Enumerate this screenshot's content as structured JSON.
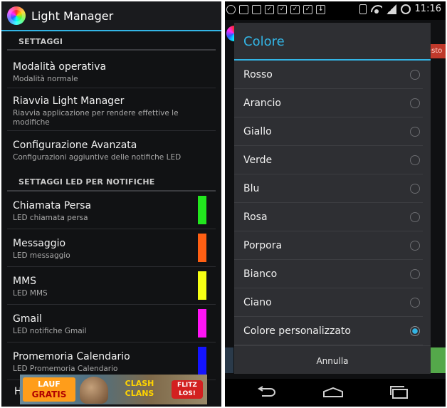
{
  "left": {
    "app_title": "Light Manager",
    "sections": {
      "settings": "SETTAGGI",
      "led_settings": "SETTAGGI LED PER NOTIFICHE"
    },
    "items": [
      {
        "title": "Modalità operativa",
        "subtitle": "Modalità normale"
      },
      {
        "title": "Riavvia Light Manager",
        "subtitle": "Riavvia applicazione per rendere effettive le modifiche"
      },
      {
        "title": "Configurazione Avanzata",
        "subtitle": "Configurazioni aggiuntive delle notifiche LED"
      }
    ],
    "led_items": [
      {
        "title": "Chiamata Persa",
        "subtitle": "LED chiamata persa",
        "color": "#22e61e"
      },
      {
        "title": "Messaggio",
        "subtitle": "LED messaggio",
        "color": "#ff5f13"
      },
      {
        "title": "MMS",
        "subtitle": "LED MMS",
        "color": "#f6ff14"
      },
      {
        "title": "Gmail",
        "subtitle": "LED notifiche Gmail",
        "color": "#ff14f5"
      },
      {
        "title": "Promemoria Calendario",
        "subtitle": "LED Promemoria Calendario",
        "color": "#1414ff"
      }
    ],
    "partial_row_text": "H",
    "ad": {
      "badge_top": "LAUF",
      "badge_bottom": "GRATIS",
      "game_top": "CLASH",
      "game_bottom": "CLANS",
      "cta_top": "FLITZ",
      "cta_bottom": "LOS!"
    }
  },
  "right": {
    "status": {
      "time": "11:16"
    },
    "behind_fragment": "esto",
    "dialog": {
      "title": "Colore",
      "options": [
        {
          "label": "Rosso",
          "selected": false
        },
        {
          "label": "Arancio",
          "selected": false
        },
        {
          "label": "Giallo",
          "selected": false
        },
        {
          "label": "Verde",
          "selected": false
        },
        {
          "label": "Blu",
          "selected": false
        },
        {
          "label": "Rosa",
          "selected": false
        },
        {
          "label": "Porpora",
          "selected": false
        },
        {
          "label": "Bianco",
          "selected": false
        },
        {
          "label": "Ciano",
          "selected": false
        },
        {
          "label": "Colore personalizzato",
          "selected": true
        }
      ],
      "cancel_label": "Annulla"
    }
  },
  "colors": {
    "accent": "#33b5e5",
    "background": "#111214",
    "dialog": "#2e2f33"
  }
}
